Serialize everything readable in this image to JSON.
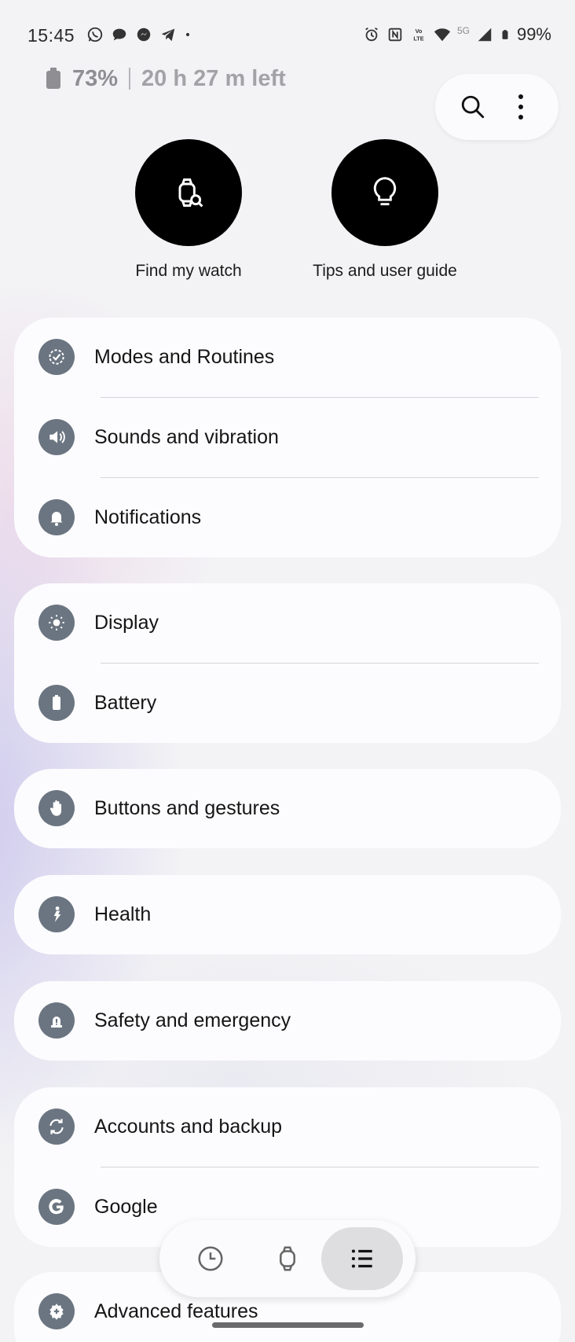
{
  "status_bar": {
    "time": "15:45",
    "notification_icons": [
      "whatsapp-icon",
      "chat-bubble-icon",
      "messenger-icon",
      "telegram-icon",
      "dot-icon"
    ],
    "system_icons": [
      "alarm-icon",
      "nfc-icon",
      "volte-icon",
      "wifi-icon",
      "5g-icon",
      "signal-icon",
      "battery-icon"
    ],
    "network_label": "5G",
    "battery_percent": "99%"
  },
  "watch_battery": {
    "percent": "73%",
    "time_left": "20 h 27 m left"
  },
  "top_actions": {
    "search_icon": "search-icon",
    "more_icon": "more-vertical-icon"
  },
  "quick_actions": [
    {
      "label": "Find my watch",
      "icon": "watch-search-icon"
    },
    {
      "label": "Tips and user guide",
      "icon": "lightbulb-icon"
    }
  ],
  "settings_groups": [
    {
      "items": [
        {
          "label": "Modes and Routines",
          "icon": "modes-routines-icon"
        },
        {
          "label": "Sounds and vibration",
          "icon": "speaker-icon"
        },
        {
          "label": "Notifications",
          "icon": "bell-icon"
        }
      ]
    },
    {
      "items": [
        {
          "label": "Display",
          "icon": "brightness-icon"
        },
        {
          "label": "Battery",
          "icon": "battery-icon"
        }
      ]
    },
    {
      "items": [
        {
          "label": "Buttons and gestures",
          "icon": "hand-icon"
        }
      ]
    },
    {
      "items": [
        {
          "label": "Health",
          "icon": "health-icon"
        }
      ]
    },
    {
      "items": [
        {
          "label": "Safety and emergency",
          "icon": "siren-icon"
        }
      ]
    },
    {
      "items": [
        {
          "label": "Accounts and backup",
          "icon": "sync-icon"
        },
        {
          "label": "Google",
          "icon": "google-icon"
        }
      ]
    },
    {
      "items": [
        {
          "label": "Advanced features",
          "icon": "gear-plus-icon"
        }
      ]
    }
  ],
  "bottom_nav": {
    "items": [
      {
        "name": "history-tab",
        "icon": "clock-icon",
        "active": false
      },
      {
        "name": "watch-tab",
        "icon": "watch-icon",
        "active": false
      },
      {
        "name": "settings-list-tab",
        "icon": "list-icon",
        "active": true
      }
    ]
  }
}
